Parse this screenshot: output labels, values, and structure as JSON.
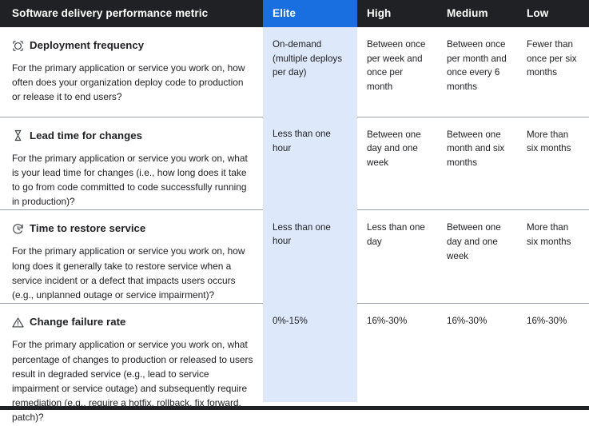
{
  "header": {
    "metric_label": "Software delivery performance metric",
    "levels": [
      "Elite",
      "High",
      "Medium",
      "Low"
    ]
  },
  "colors": {
    "header_bg": "#202124",
    "elite_header_bg": "#1a6fe0",
    "elite_column_bg": "#dde8fb",
    "text": "#202124",
    "rule": "#9aa0a6"
  },
  "rows": [
    {
      "icon": "deployment-frequency-icon",
      "title": "Deployment frequency",
      "description": "For the primary application or service you work on, how often does your organization deploy code to production or release it to end users?",
      "elite": "On-demand (multiple deploys per day)",
      "high": "Between once per week and once per month",
      "medium": "Between once per month and once every 6 months",
      "low": "Fewer than once per six months"
    },
    {
      "icon": "hourglass-icon",
      "title": "Lead time for changes",
      "description": "For the primary application or service you work on, what is your lead time for changes (i.e., how long does it take to go from code committed to code successfully running in production)?",
      "elite": "Less than one hour",
      "high": "Between one day and one week",
      "medium": "Between one month and six months",
      "low": "More than six months"
    },
    {
      "icon": "clock-restore-icon",
      "title": "Time to restore service",
      "description": "For the primary application or service you work on, how long does it generally take to restore service when a service incident or a defect that impacts users occurs (e.g., unplanned outage or service impairment)?",
      "elite": "Less than one hour",
      "high": "Less than one day",
      "medium": "Between one day and one week",
      "low": "More than six months"
    },
    {
      "icon": "warning-triangle-icon",
      "title": "Change failure rate",
      "description": "For the primary application or service you work on, what percentage of changes to production or released to users result in degraded service (e.g., lead to service impairment or service outage) and subsequently require remediation (e.g., require a hotfix, rollback, fix forward, patch)?",
      "elite": "0%-15%",
      "high": "16%-30%",
      "medium": "16%-30%",
      "low": "16%-30%"
    }
  ]
}
